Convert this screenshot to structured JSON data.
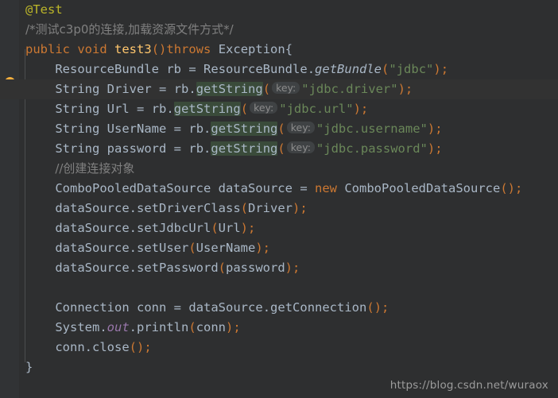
{
  "editor": {
    "theme": "darcula",
    "background": "#2e2f30",
    "gutter_background": "#313335",
    "current_line_background": "#323232",
    "occurrence_highlight": "#3a4b3a",
    "gutter_icon": "lightbulb-icon",
    "caret_line_index": 4
  },
  "colors": {
    "annotation": "#bbb529",
    "comment": "#808080",
    "keyword": "#cc7832",
    "method_declaration": "#ffc66d",
    "identifier": "#a9b7c6",
    "string": "#6a8759",
    "static_field": "#9876aa",
    "inlay_hint_bg": "#3f4244",
    "inlay_hint_fg": "#8c8c8c"
  },
  "lines": [
    {
      "indent": 0,
      "tokens": [
        {
          "t": "ann",
          "v": "@Test"
        }
      ]
    },
    {
      "indent": 0,
      "tokens": [
        {
          "t": "cmt",
          "v": "/*测试c3p0的连接,加载资源文件方式*/",
          "cjk": true
        }
      ]
    },
    {
      "indent": 0,
      "tokens": [
        {
          "t": "kw",
          "v": "public"
        },
        {
          "t": "plain",
          "v": " "
        },
        {
          "t": "kw",
          "v": "void"
        },
        {
          "t": "plain",
          "v": " "
        },
        {
          "t": "meth",
          "v": "test3"
        },
        {
          "t": "paren",
          "v": "()"
        },
        {
          "t": "kw",
          "v": "throws"
        },
        {
          "t": "plain",
          "v": " "
        },
        {
          "t": "type",
          "v": "Exception"
        },
        {
          "t": "brace",
          "v": "{"
        }
      ]
    },
    {
      "indent": 1,
      "tokens": [
        {
          "t": "type",
          "v": "ResourceBundle"
        },
        {
          "t": "plain",
          "v": " "
        },
        {
          "t": "ident",
          "v": "rb"
        },
        {
          "t": "plain",
          "v": " "
        },
        {
          "t": "punc",
          "v": "="
        },
        {
          "t": "plain",
          "v": " "
        },
        {
          "t": "type",
          "v": "ResourceBundle"
        },
        {
          "t": "punc",
          "v": "."
        },
        {
          "t": "ital",
          "v": "getBundle"
        },
        {
          "t": "paren",
          "v": "("
        },
        {
          "t": "str",
          "v": "\"jdbc\""
        },
        {
          "t": "paren",
          "v": ")"
        },
        {
          "t": "semi",
          "v": ";"
        }
      ]
    },
    {
      "indent": 1,
      "current": true,
      "tokens": [
        {
          "t": "type",
          "v": "String"
        },
        {
          "t": "plain",
          "v": " "
        },
        {
          "t": "ident",
          "v": "Driver"
        },
        {
          "t": "plain",
          "v": " "
        },
        {
          "t": "punc",
          "v": "="
        },
        {
          "t": "plain",
          "v": " "
        },
        {
          "t": "ident",
          "v": "rb"
        },
        {
          "t": "punc",
          "v": "."
        },
        {
          "t": "caret",
          "v": ""
        },
        {
          "t": "occ",
          "v": "getString"
        },
        {
          "t": "paren",
          "v": "("
        },
        {
          "t": "hint",
          "v": "key:"
        },
        {
          "t": "str",
          "v": "\"jdbc.driver\""
        },
        {
          "t": "paren",
          "v": ")"
        },
        {
          "t": "semi",
          "v": ";"
        }
      ]
    },
    {
      "indent": 1,
      "tokens": [
        {
          "t": "type",
          "v": "String"
        },
        {
          "t": "plain",
          "v": " "
        },
        {
          "t": "ident",
          "v": "Url"
        },
        {
          "t": "plain",
          "v": " "
        },
        {
          "t": "punc",
          "v": "="
        },
        {
          "t": "plain",
          "v": " "
        },
        {
          "t": "ident",
          "v": "rb"
        },
        {
          "t": "punc",
          "v": "."
        },
        {
          "t": "occ",
          "v": "getString"
        },
        {
          "t": "paren",
          "v": "("
        },
        {
          "t": "hint",
          "v": "key:"
        },
        {
          "t": "str",
          "v": "\"jdbc.url\""
        },
        {
          "t": "paren",
          "v": ")"
        },
        {
          "t": "semi",
          "v": ";"
        }
      ]
    },
    {
      "indent": 1,
      "tokens": [
        {
          "t": "type",
          "v": "String"
        },
        {
          "t": "plain",
          "v": " "
        },
        {
          "t": "ident",
          "v": "UserName"
        },
        {
          "t": "plain",
          "v": " "
        },
        {
          "t": "punc",
          "v": "="
        },
        {
          "t": "plain",
          "v": " "
        },
        {
          "t": "ident",
          "v": "rb"
        },
        {
          "t": "punc",
          "v": "."
        },
        {
          "t": "occ",
          "v": "getString"
        },
        {
          "t": "paren",
          "v": "("
        },
        {
          "t": "hint",
          "v": "key:"
        },
        {
          "t": "str",
          "v": "\"jdbc.username\""
        },
        {
          "t": "paren",
          "v": ")"
        },
        {
          "t": "semi",
          "v": ";"
        }
      ]
    },
    {
      "indent": 1,
      "tokens": [
        {
          "t": "type",
          "v": "String"
        },
        {
          "t": "plain",
          "v": " "
        },
        {
          "t": "ident",
          "v": "password"
        },
        {
          "t": "plain",
          "v": " "
        },
        {
          "t": "punc",
          "v": "="
        },
        {
          "t": "plain",
          "v": " "
        },
        {
          "t": "ident",
          "v": "rb"
        },
        {
          "t": "punc",
          "v": "."
        },
        {
          "t": "occ",
          "v": "getString"
        },
        {
          "t": "paren",
          "v": "("
        },
        {
          "t": "hint",
          "v": "key:"
        },
        {
          "t": "str",
          "v": "\"jdbc.password\""
        },
        {
          "t": "paren",
          "v": ")"
        },
        {
          "t": "semi",
          "v": ";"
        }
      ]
    },
    {
      "indent": 1,
      "tokens": [
        {
          "t": "cmt",
          "v": "//创建连接对象",
          "cjk": true
        }
      ]
    },
    {
      "indent": 1,
      "tokens": [
        {
          "t": "type",
          "v": "ComboPooledDataSource"
        },
        {
          "t": "plain",
          "v": " "
        },
        {
          "t": "ident",
          "v": "dataSource"
        },
        {
          "t": "plain",
          "v": " "
        },
        {
          "t": "punc",
          "v": "="
        },
        {
          "t": "plain",
          "v": " "
        },
        {
          "t": "kw",
          "v": "new"
        },
        {
          "t": "plain",
          "v": " "
        },
        {
          "t": "type",
          "v": "ComboPooledDataSource"
        },
        {
          "t": "paren",
          "v": "()"
        },
        {
          "t": "semi",
          "v": ";"
        }
      ]
    },
    {
      "indent": 1,
      "tokens": [
        {
          "t": "ident",
          "v": "dataSource"
        },
        {
          "t": "punc",
          "v": "."
        },
        {
          "t": "ident",
          "v": "setDriverClass"
        },
        {
          "t": "paren",
          "v": "("
        },
        {
          "t": "ident",
          "v": "Driver"
        },
        {
          "t": "paren",
          "v": ")"
        },
        {
          "t": "semi",
          "v": ";"
        }
      ]
    },
    {
      "indent": 1,
      "tokens": [
        {
          "t": "ident",
          "v": "dataSource"
        },
        {
          "t": "punc",
          "v": "."
        },
        {
          "t": "ident",
          "v": "setJdbcUrl"
        },
        {
          "t": "paren",
          "v": "("
        },
        {
          "t": "ident",
          "v": "Url"
        },
        {
          "t": "paren",
          "v": ")"
        },
        {
          "t": "semi",
          "v": ";"
        }
      ]
    },
    {
      "indent": 1,
      "tokens": [
        {
          "t": "ident",
          "v": "dataSource"
        },
        {
          "t": "punc",
          "v": "."
        },
        {
          "t": "ident",
          "v": "setUser"
        },
        {
          "t": "paren",
          "v": "("
        },
        {
          "t": "ident",
          "v": "UserName"
        },
        {
          "t": "paren",
          "v": ")"
        },
        {
          "t": "semi",
          "v": ";"
        }
      ]
    },
    {
      "indent": 1,
      "tokens": [
        {
          "t": "ident",
          "v": "dataSource"
        },
        {
          "t": "punc",
          "v": "."
        },
        {
          "t": "ident",
          "v": "setPassword"
        },
        {
          "t": "paren",
          "v": "("
        },
        {
          "t": "ident",
          "v": "password"
        },
        {
          "t": "paren",
          "v": ")"
        },
        {
          "t": "semi",
          "v": ";"
        }
      ]
    },
    {
      "indent": 1,
      "tokens": []
    },
    {
      "indent": 1,
      "tokens": [
        {
          "t": "type",
          "v": "Connection"
        },
        {
          "t": "plain",
          "v": " "
        },
        {
          "t": "ident",
          "v": "conn"
        },
        {
          "t": "plain",
          "v": " "
        },
        {
          "t": "punc",
          "v": "="
        },
        {
          "t": "plain",
          "v": " "
        },
        {
          "t": "ident",
          "v": "dataSource"
        },
        {
          "t": "punc",
          "v": "."
        },
        {
          "t": "ident",
          "v": "getConnection"
        },
        {
          "t": "paren",
          "v": "()"
        },
        {
          "t": "semi",
          "v": ";"
        }
      ]
    },
    {
      "indent": 1,
      "tokens": [
        {
          "t": "type",
          "v": "System"
        },
        {
          "t": "punc",
          "v": "."
        },
        {
          "t": "static",
          "v": "out"
        },
        {
          "t": "punc",
          "v": "."
        },
        {
          "t": "ident",
          "v": "println"
        },
        {
          "t": "paren",
          "v": "("
        },
        {
          "t": "ident",
          "v": "conn"
        },
        {
          "t": "paren",
          "v": ")"
        },
        {
          "t": "semi",
          "v": ";"
        }
      ]
    },
    {
      "indent": 1,
      "tokens": [
        {
          "t": "ident",
          "v": "conn"
        },
        {
          "t": "punc",
          "v": "."
        },
        {
          "t": "ident",
          "v": "close"
        },
        {
          "t": "paren",
          "v": "()"
        },
        {
          "t": "semi",
          "v": ";"
        }
      ]
    },
    {
      "indent": 0,
      "tokens": [
        {
          "t": "brace",
          "v": "}"
        }
      ]
    }
  ],
  "watermark": {
    "text": "https://blog.csdn.net/wuraox"
  }
}
